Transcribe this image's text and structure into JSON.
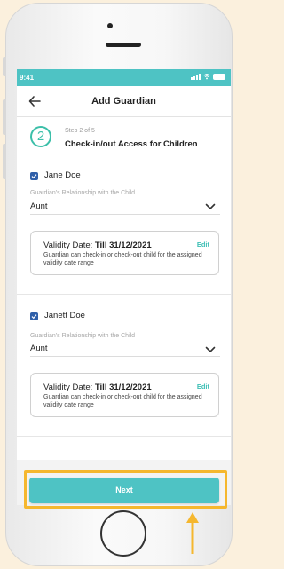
{
  "status_bar": {
    "time": "9:41"
  },
  "header": {
    "title": "Add Guardian"
  },
  "step": {
    "number": "2",
    "label": "Step 2 of 5",
    "title": "Check-in/out Access for Children"
  },
  "guardians": [
    {
      "name": "Jane Doe",
      "checked": true,
      "relationship_label": "Guardian's Relationship with the Child",
      "relationship_value": "Aunt",
      "validity_prefix": "Validity Date:",
      "validity_value": "Till 31/12/2021",
      "edit_label": "Edit",
      "description": "Guardian can check-in or check-out child for the assigned validity date range"
    },
    {
      "name": "Janett Doe",
      "checked": true,
      "relationship_label": "Guardian's Relationship with the Child",
      "relationship_value": "Aunt",
      "validity_prefix": "Validity Date:",
      "validity_value": "Till 31/12/2021",
      "edit_label": "Edit",
      "description": "Guardian can check-in or check-out child for the assigned validity date range"
    }
  ],
  "footer": {
    "next_label": "Next"
  },
  "colors": {
    "accent": "#4ec3c4",
    "step_green": "#3cbfa9",
    "checkbox": "#2f5fa8",
    "highlight": "#f5b72e",
    "background": "#fbf0dd"
  },
  "icons": [
    "back-arrow-icon",
    "chevron-down-icon",
    "checkbox-checked-icon",
    "signal-icon",
    "wifi-icon",
    "battery-icon"
  ]
}
